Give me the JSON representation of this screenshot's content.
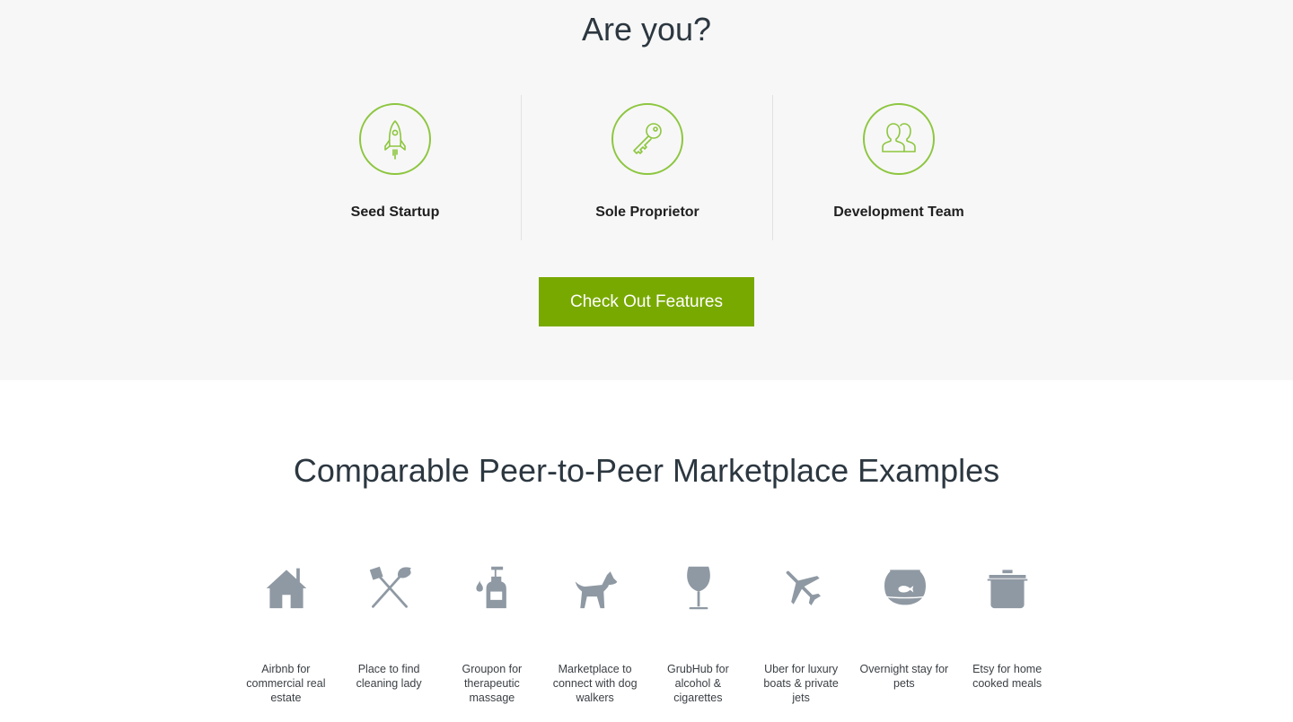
{
  "top": {
    "title": "Are you?",
    "personas": [
      {
        "label": "Seed Startup",
        "icon": "rocket-icon"
      },
      {
        "label": "Sole Proprietor",
        "icon": "key-icon"
      },
      {
        "label": "Development Team",
        "icon": "team-icon"
      }
    ],
    "cta_label": "Check Out Features"
  },
  "examples": {
    "title": "Comparable Peer-to-Peer Marketplace Examples",
    "items": [
      {
        "label": "Airbnb for commercial real estate",
        "icon": "house-icon"
      },
      {
        "label": "Place to find cleaning lady",
        "icon": "broom-icon"
      },
      {
        "label": "Groupon for therapeutic massage",
        "icon": "lotion-bottle-icon"
      },
      {
        "label": "Marketplace to connect with dog walkers",
        "icon": "dog-icon"
      },
      {
        "label": "GrubHub for alcohol & cigarettes",
        "icon": "wine-glass-icon"
      },
      {
        "label": "Uber for luxury boats & private jets",
        "icon": "airplane-icon"
      },
      {
        "label": "Overnight stay for pets",
        "icon": "fishbowl-icon"
      },
      {
        "label": "Etsy for home cooked meals",
        "icon": "cooking-pot-icon"
      }
    ]
  },
  "colors": {
    "accent": "#8dc63f",
    "button": "#78a900",
    "icon_gray": "#8f99a3",
    "top_bg": "#f7f7f7"
  }
}
